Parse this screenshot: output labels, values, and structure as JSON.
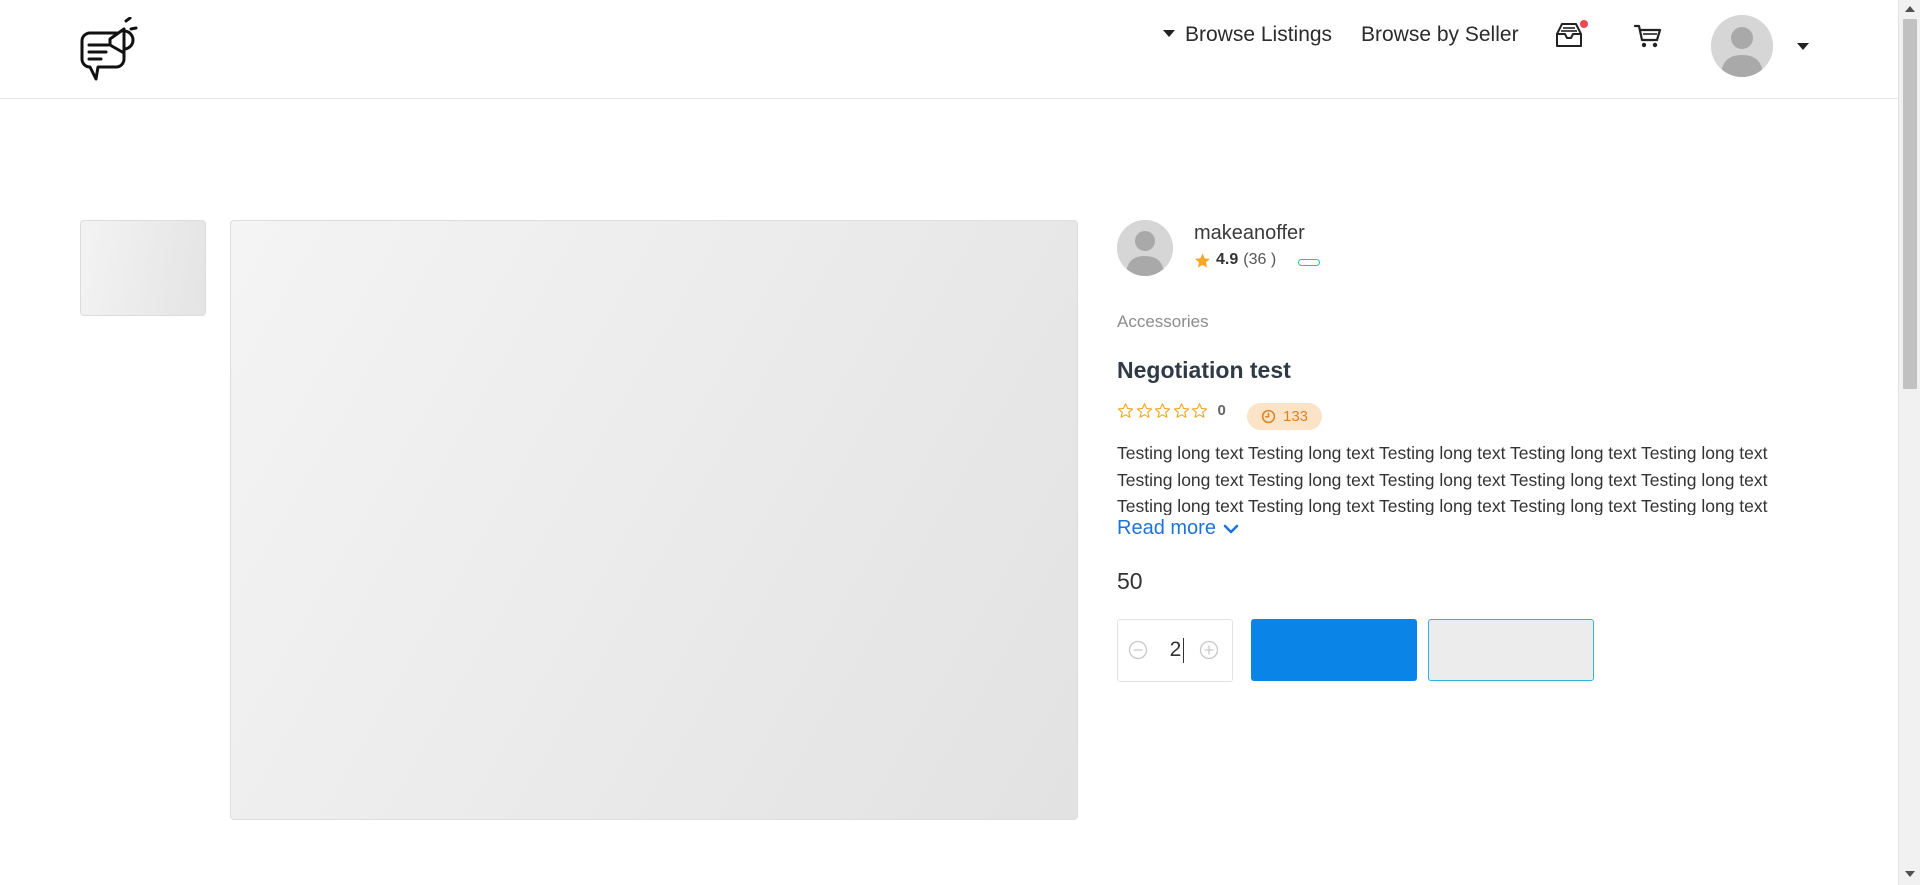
{
  "header": {
    "logo_icon": "megaphone-chat-logo-icon",
    "nav": {
      "browse_listings": "Browse Listings",
      "browse_by_seller": "Browse by Seller"
    },
    "icons": {
      "inbox": "inbox-icon",
      "cart": "cart-icon",
      "avatar": "user-avatar-icon",
      "dropdown": "caret-down-icon"
    },
    "notification_color": "#ea4a4a"
  },
  "seller": {
    "name": "makeanoffer",
    "rating": "4.9",
    "rating_count": "(36 )"
  },
  "listing": {
    "category": "Accessories",
    "title": "Negotiation test",
    "stars": 0,
    "review_count": "0",
    "time_value": "133",
    "description": "Testing long text Testing long text Testing long text Testing long text Testing long text Testing long text Testing long text Testing long text Testing long text Testing long text Testing long text Testing long text Testing long text Testing long text Testing long text",
    "read_more": "Read more",
    "price": "50",
    "quantity": "2"
  },
  "colors": {
    "primary_button": "#0a84e6",
    "secondary_border": "#2ab7d8",
    "link": "#1e73d8",
    "star": "#f5a623",
    "badge_bg": "#fbe3c8",
    "badge_text": "#d9822b"
  }
}
